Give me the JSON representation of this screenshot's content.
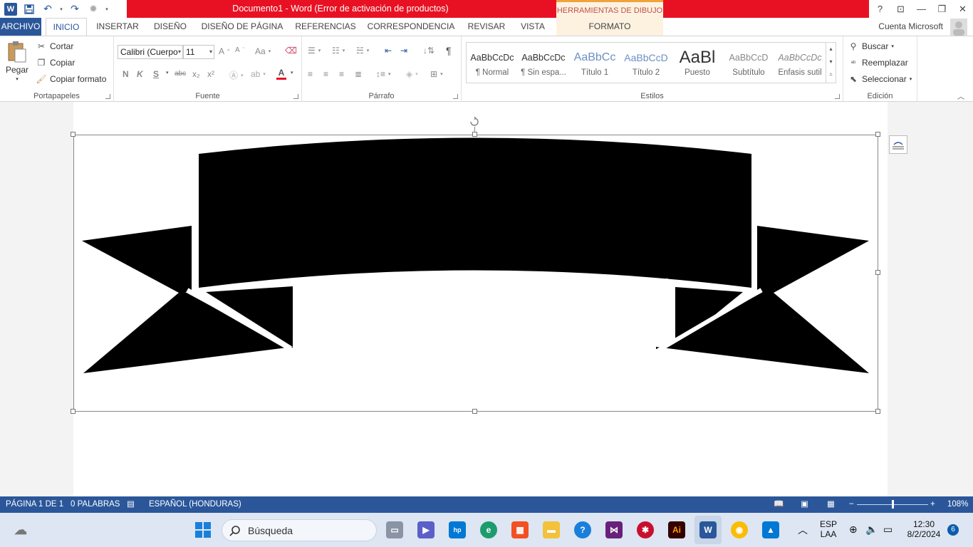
{
  "titlebar": {
    "title": "Documento1 -  Word (Error de activación de productos)",
    "tools_tab": "HERRAMIENTAS DE DIBUJO"
  },
  "tabs": {
    "file": "ARCHIVO",
    "items": [
      "INICIO",
      "INSERTAR",
      "DISEÑO",
      "DISEÑO DE PÁGINA",
      "REFERENCIAS",
      "CORRESPONDENCIA",
      "REVISAR",
      "VISTA",
      "FORMATO"
    ],
    "account": "Cuenta Microsoft"
  },
  "clipboard": {
    "paste": "Pegar",
    "cut": "Cortar",
    "copy": "Copiar",
    "format_painter": "Copiar formato",
    "label": "Portapapeles"
  },
  "font": {
    "family": "Calibri (Cuerpo",
    "size": "11",
    "label": "Fuente",
    "bold": "N",
    "italic": "K",
    "underline": "S",
    "strike": "abc",
    "sub": "x₂",
    "sup": "x²",
    "case": "Aa",
    "grow": "A",
    "shrink": "A"
  },
  "paragraph": {
    "label": "Párrafo"
  },
  "styles": {
    "label": "Estilos",
    "items": [
      {
        "sample": "AaBbCcDc",
        "name": "¶ Normal"
      },
      {
        "sample": "AaBbCcDc",
        "name": "¶ Sin espa..."
      },
      {
        "sample": "AaBbCc",
        "name": "Título 1"
      },
      {
        "sample": "AaBbCcD",
        "name": "Título 2"
      },
      {
        "sample": "AaBl",
        "name": "Puesto"
      },
      {
        "sample": "AaBbCcD",
        "name": "Subtítulo"
      },
      {
        "sample": "AaBbCcDc",
        "name": "Énfasis sutil"
      }
    ]
  },
  "editing": {
    "label": "Edición",
    "find": "Buscar",
    "replace": "Reemplazar",
    "select": "Seleccionar"
  },
  "status": {
    "page": "PÁGINA 1 DE 1",
    "words": "0 PALABRAS",
    "language": "ESPAÑOL (HONDURAS)",
    "zoom": "108%"
  },
  "taskbar": {
    "search": "Búsqueda",
    "lang1": "ESP",
    "lang2": "LAA",
    "time": "12:30",
    "date": "8/2/2024",
    "notifications": "6"
  },
  "colors": {
    "word_blue": "#2b579a",
    "title_red": "#e81123",
    "tools_orange": "#f0a23b"
  }
}
